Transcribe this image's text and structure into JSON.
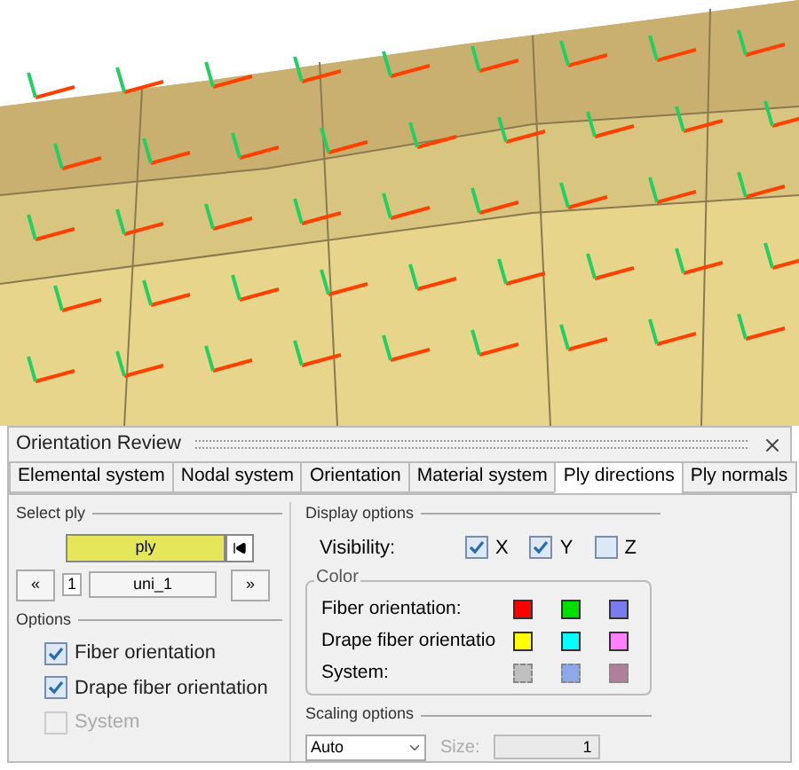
{
  "window": {
    "title": "Orientation Review"
  },
  "tabs": [
    {
      "label": "Elemental system",
      "selected": false
    },
    {
      "label": "Nodal system",
      "selected": false
    },
    {
      "label": "Orientation",
      "selected": false
    },
    {
      "label": "Material system",
      "selected": false
    },
    {
      "label": "Ply directions",
      "selected": true
    },
    {
      "label": "Ply normals",
      "selected": false
    }
  ],
  "select_ply": {
    "label": "Select ply",
    "button": "ply",
    "prev": "«",
    "index": "1",
    "name": "uni_1",
    "next": "»"
  },
  "options": {
    "label": "Options",
    "items": [
      {
        "label": "Fiber orientation",
        "checked": true,
        "disabled": false
      },
      {
        "label": "Drape fiber orientation",
        "checked": true,
        "disabled": false
      },
      {
        "label": "System",
        "checked": false,
        "disabled": true
      }
    ]
  },
  "display_options": {
    "label": "Display options",
    "visibility_label": "Visibility:",
    "axes": [
      {
        "label": "X",
        "checked": true
      },
      {
        "label": "Y",
        "checked": true
      },
      {
        "label": "Z",
        "checked": false
      }
    ]
  },
  "color": {
    "label": "Color",
    "rows": [
      {
        "label": "Fiber orientation:",
        "disabled": false,
        "swatches": [
          {
            "color": "#ff0000"
          },
          {
            "color": "#00e000"
          },
          {
            "color": "#7b7bf0"
          }
        ]
      },
      {
        "label": "Drape fiber orientatio",
        "disabled": false,
        "swatches": [
          {
            "color": "#ffff00"
          },
          {
            "color": "#00ffff"
          },
          {
            "color": "#ff80ff"
          }
        ]
      },
      {
        "label": "System:",
        "disabled": true,
        "swatches": [
          {
            "color": "#c0c0c0"
          },
          {
            "color": "#8fa8e8"
          },
          {
            "color": "#b0809a"
          }
        ]
      }
    ]
  },
  "scaling": {
    "label": "Scaling options",
    "mode": "Auto",
    "size_label": "Size:",
    "size": "1",
    "size_disabled": true
  }
}
